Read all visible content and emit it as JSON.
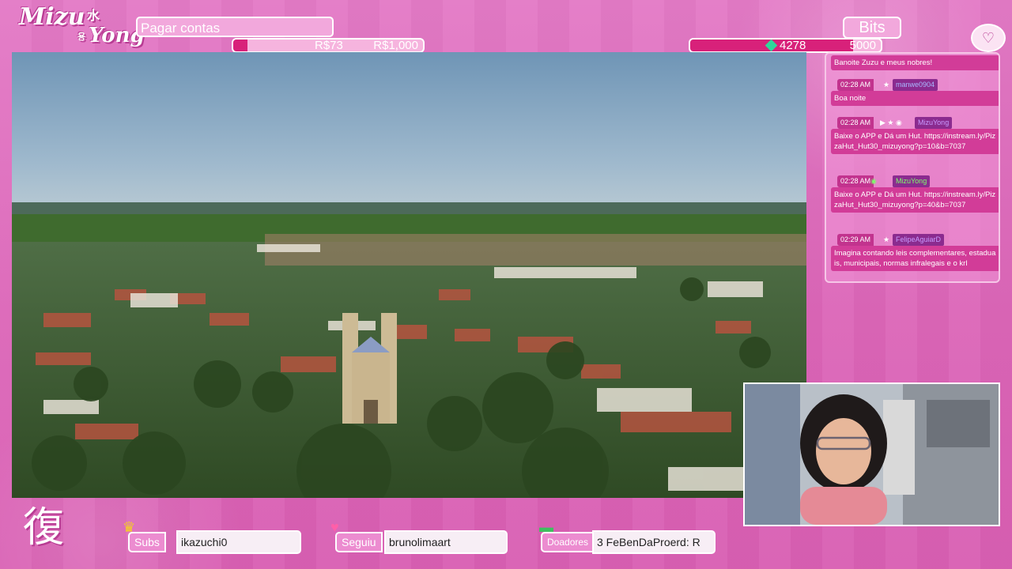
{
  "logo": {
    "line1": "Mizu",
    "kanji": "水",
    "small": "용",
    "line2": "Yong"
  },
  "goal": {
    "title": "Pagar contas",
    "current": "R$73",
    "target": "R$1,000",
    "progress": 0.073
  },
  "bits": {
    "title": "Bits",
    "current": "4278",
    "target": "5000",
    "progress": 0.856
  },
  "chat": {
    "messages": [
      {
        "time": "",
        "user": "",
        "text": "Banoite Zuzu e meus nobres!"
      },
      {
        "time": "02:28 AM",
        "badges": "★",
        "user": "manwe0904",
        "user_color": "#a9b8ff",
        "text": "Boa noite"
      },
      {
        "time": "02:28 AM",
        "badges": "▶ ★ ◉",
        "user": "MizuYong",
        "user_color": "#c99bff",
        "text": "Baixe o APP e Dá um Hut. https://instream.ly/PizzaHut_Hut30_mizuyong?p=10&b=7037"
      },
      {
        "time": "02:28 AM",
        "badges": "◉",
        "user": "MizuYong",
        "user_color": "#7dff6a",
        "text": "Baixe o APP e Dá um Hut. https://instream.ly/PizzaHut_Hut30_mizuyong?p=40&b=7037"
      },
      {
        "time": "02:29 AM",
        "badges": "★",
        "user": "FelipeAguiarD",
        "user_color": "#c99bff",
        "text": "Imagina contando leis complementares, estaduais, municipais, normas infralegais e o krl"
      }
    ]
  },
  "bottom": {
    "icon": "復",
    "subs_label": "Subs",
    "subs_value": "ikazuchi0",
    "follow_label": "Seguiu",
    "follow_value": "brunolimaart",
    "donors_label": "Doadores",
    "donors_value": "3   FeBenDaProerd: R"
  },
  "colors": {
    "frame": "#e06fbe",
    "accent": "#d8217a",
    "chat_body": "#d23c98"
  }
}
